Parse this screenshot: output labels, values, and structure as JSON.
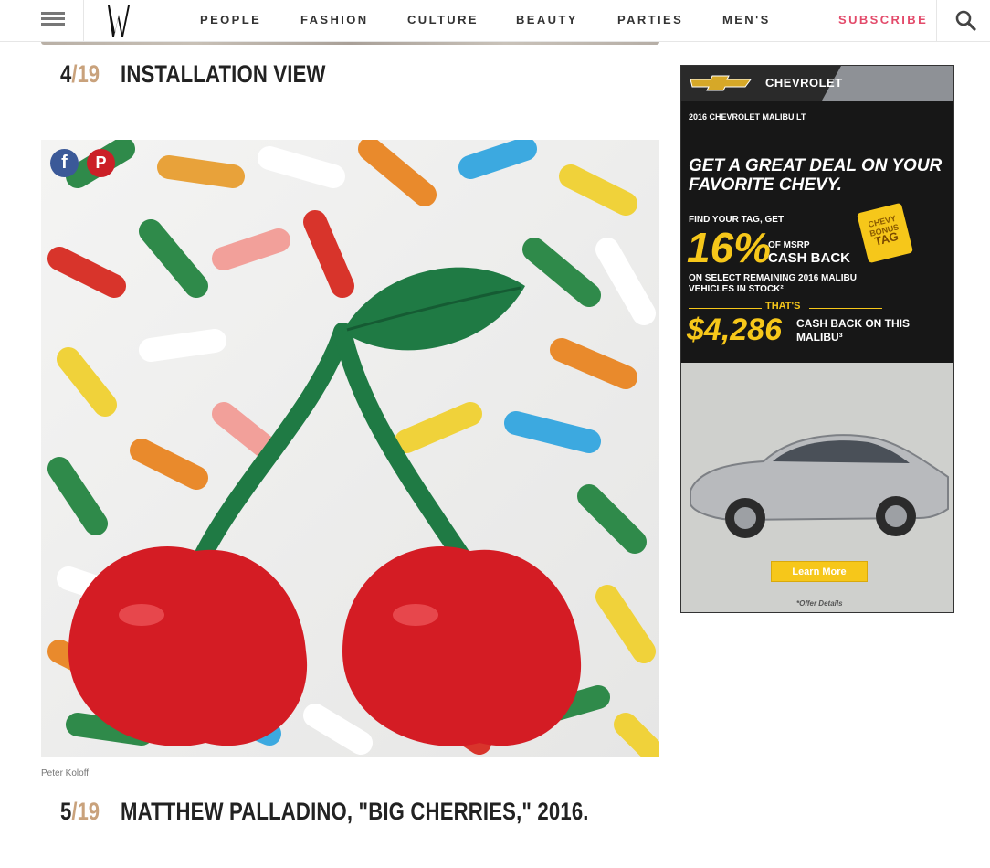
{
  "nav": {
    "items": [
      "PEOPLE",
      "FASHION",
      "CULTURE",
      "BEAUTY",
      "PARTIES",
      "MEN'S"
    ],
    "subscribe_label": "SUBSCRIBE",
    "logo_letter": "W"
  },
  "slides": [
    {
      "current": "4",
      "total": "/19",
      "title": "INSTALLATION VIEW"
    },
    {
      "current": "5",
      "total": "/19",
      "title": "MATTHEW PALLADINO, \"BIG CHERRIES,\" 2016."
    }
  ],
  "photo": {
    "credit": "Peter Koloff",
    "share": {
      "facebook_glyph": "f",
      "pinterest_glyph": "P"
    }
  },
  "ad": {
    "brand": "CHEVROLET",
    "model": "2016 CHEVROLET MALIBU LT",
    "headline": "GET A GREAT DEAL ON YOUR FAVORITE CHEVY.",
    "find_tag": "FIND YOUR TAG, GET",
    "percent": "16%",
    "msrp_label": "OF MSRP",
    "cash_back_1": "CASH BACK",
    "select_text": "ON SELECT REMAINING 2016 MALIBU VEHICLES IN STOCK²",
    "thats": "THAT'S",
    "amount": "$4,286",
    "cash_back_2": "CASH BACK ON THIS MALIBU³",
    "tag_line1": "CHEVY",
    "tag_line2": "BONUS",
    "tag_line3": "TAG",
    "button": "Learn More",
    "details": "*Offer Details"
  },
  "colors": {
    "accent_subscribe": "#e34a6a",
    "slide_total": "#c9a27c",
    "facebook": "#3b5998",
    "pinterest": "#cb2027",
    "ad_yellow": "#f6c71a"
  }
}
